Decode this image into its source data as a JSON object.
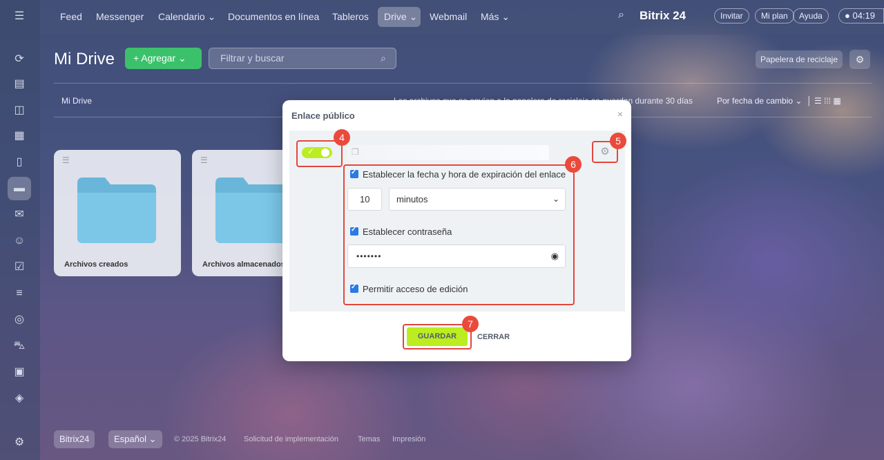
{
  "topbar": {
    "nav": [
      "Feed",
      "Messenger",
      "Calendario",
      "Documentos en línea",
      "Tableros",
      "Drive",
      "Webmail",
      "Más"
    ],
    "brand": "Bitrix 24",
    "invite": "Invitar",
    "plan": "Mi plan",
    "help": "Ayuda",
    "clock": "04:19"
  },
  "page": {
    "title": "Mi Drive",
    "add_label": "Agregar",
    "search_placeholder": "Filtrar y buscar",
    "trash_label": "Papelera de reciclaje",
    "breadcrumb": "Mi Drive",
    "hint": "Los archivos que se envíen a la papelera de reciclaje se guardan durante 30 días",
    "sort": "Por fecha de cambio"
  },
  "folders": [
    {
      "label": "Archivos creados"
    },
    {
      "label": "Archivos almacenados"
    }
  ],
  "footer": {
    "brand": "Bitrix24",
    "language": "Español",
    "links": [
      "© 2025 Bitrix24",
      "Solicitud de implementación",
      "Temas",
      "Impresión"
    ]
  },
  "modal": {
    "title": "Enlace público",
    "close": "×",
    "expiration_label": "Establecer la fecha y hora de expiración del enlace",
    "expiration_value": "10",
    "expiration_unit": "minutos",
    "password_label": "Establecer contraseña",
    "password_value": "•••••••",
    "edit_label": "Permitir acceso de edición",
    "save": "GUARDAR",
    "cancel": "CERRAR"
  },
  "annotations": [
    "4",
    "5",
    "6",
    "7"
  ],
  "colors": {
    "accent_green": "#bbed21",
    "checkbox_blue": "#2a7ae4",
    "annotation_red": "#e4453a"
  }
}
